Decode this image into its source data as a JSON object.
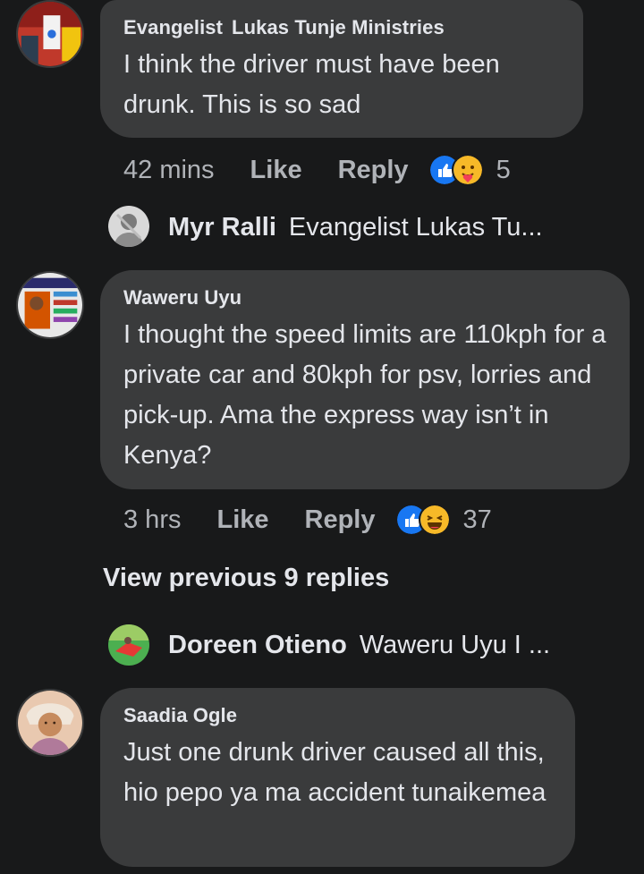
{
  "comments": [
    {
      "author_first": "Evangelist",
      "author_rest": "Lukas Tunje Ministries",
      "text": "I think the driver must have been drunk. This is so sad",
      "time": "42 mins",
      "like": "Like",
      "reply": "Reply",
      "reaction_count": "5",
      "reactions": [
        "like-reaction-icon",
        "care-reaction-icon"
      ]
    },
    {
      "author": "Waweru Uyu",
      "text": "I thought the speed limits are 110kph for a private car and 80kph for psv, lorries and pick-up. Ama the express way isn’t in Kenya?",
      "time": "3 hrs",
      "like": "Like",
      "reply": "Reply",
      "reaction_count": "37",
      "reactions": [
        "like-reaction-icon",
        "haha-reaction-icon"
      ]
    },
    {
      "author": "Saadia Ogle",
      "text": "Just one drunk driver caused all this, hio pepo ya ma accident tunaikemea"
    }
  ],
  "replies": [
    {
      "name": "Myr Ralli",
      "snippet": "Evangelist  Lukas Tu..."
    },
    {
      "name": "Doreen Otieno",
      "snippet": "Waweru Uyu I ..."
    }
  ],
  "view_previous": "View previous 9 replies",
  "colors": {
    "background": "#18191a",
    "bubble": "#3a3b3c",
    "text": "#e4e6eb",
    "secondary_text": "#b0b3b8",
    "like_blue": "#1877f2",
    "reaction_yellow": "#f7b928"
  }
}
